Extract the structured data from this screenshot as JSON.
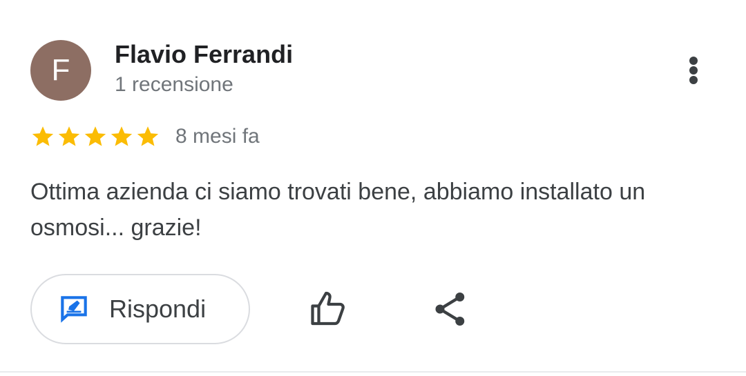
{
  "review": {
    "author": {
      "initial": "F",
      "name": "Flavio Ferrandi",
      "meta": "1 recensione",
      "avatar_color": "#8d6e63"
    },
    "rating": 5,
    "rating_max": 5,
    "date": "8 mesi fa",
    "text": "Ottima azienda ci siamo trovati bene, abbiamo installato un osmosi... grazie!"
  },
  "actions": {
    "reply_label": "Rispondi",
    "reply_icon": "reply-icon",
    "like_icon": "thumb-up-icon",
    "share_icon": "share-icon",
    "more_icon": "more-vert-icon"
  },
  "colors": {
    "star": "#fbbc04",
    "reply_icon": "#1a73e8",
    "text": "#3c4043",
    "secondary": "#70757a"
  }
}
